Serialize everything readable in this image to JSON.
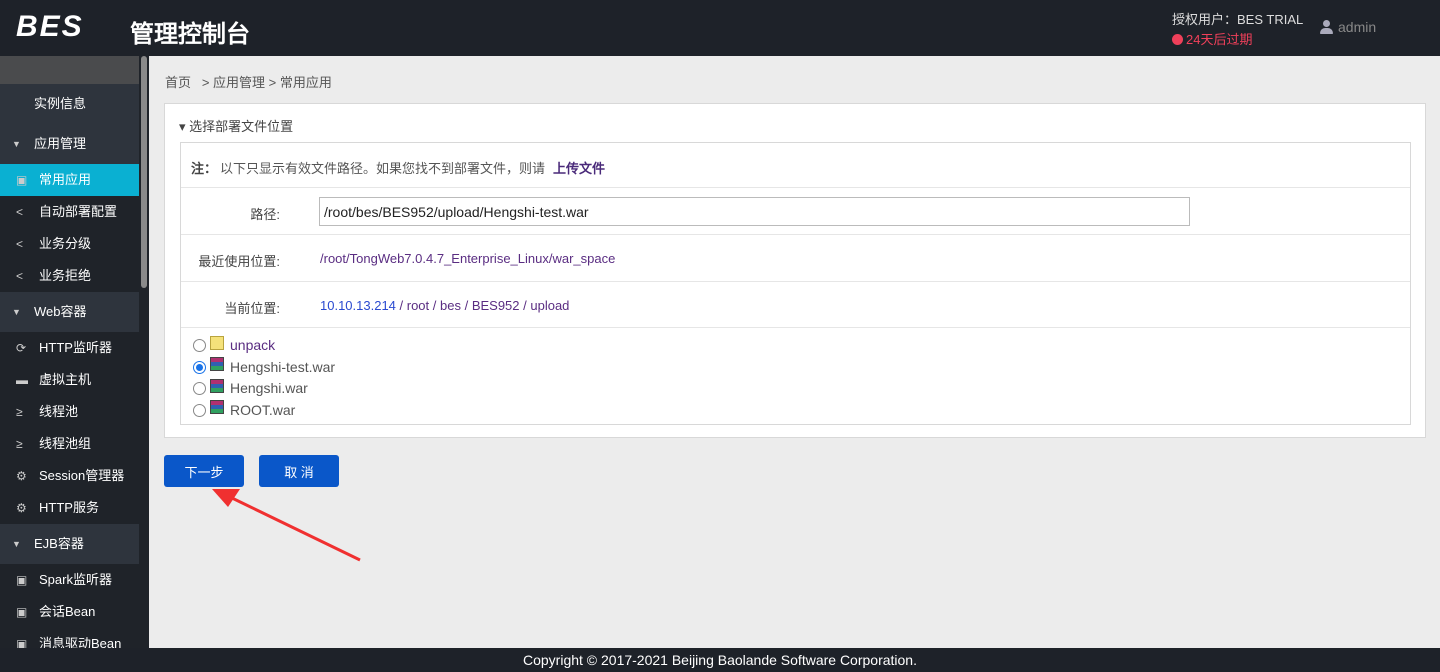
{
  "header": {
    "logo": "BES",
    "title": "管理控制台",
    "license": "授权用户：BES TRIAL",
    "expiry": "24天后过期",
    "user": "admin"
  },
  "sidebar": [
    {
      "type": "plain",
      "label": "实例信息"
    },
    {
      "type": "group",
      "label": "应用管理"
    },
    {
      "type": "item",
      "label": "常用应用",
      "icon": "app-icon",
      "active": true
    },
    {
      "type": "item",
      "label": "自动部署配置",
      "icon": "share-icon"
    },
    {
      "type": "item",
      "label": "业务分级",
      "icon": "share-icon"
    },
    {
      "type": "item",
      "label": "业务拒绝",
      "icon": "share-icon"
    },
    {
      "type": "group",
      "label": "Web容器"
    },
    {
      "type": "item",
      "label": "HTTP监听器",
      "icon": "sync-icon"
    },
    {
      "type": "item",
      "label": "虚拟主机",
      "icon": "monitor-icon"
    },
    {
      "type": "item",
      "label": "线程池",
      "icon": "thread-icon"
    },
    {
      "type": "item",
      "label": "线程池组",
      "icon": "thread-icon"
    },
    {
      "type": "item",
      "label": "Session管理器",
      "icon": "gear-icon"
    },
    {
      "type": "item",
      "label": "HTTP服务",
      "icon": "gear-icon"
    },
    {
      "type": "group",
      "label": "EJB容器"
    },
    {
      "type": "item",
      "label": "Spark监听器",
      "icon": "app-icon"
    },
    {
      "type": "item",
      "label": "会话Bean",
      "icon": "app-icon"
    },
    {
      "type": "item",
      "label": "消息驱动Bean",
      "icon": "app-icon"
    }
  ],
  "breadcrumb": "首页   > 应用管理 > 常用应用",
  "panel": {
    "title": "选择部署文件位置",
    "note_label": "注：",
    "note": "以下只显示有效文件路径。如果您找不到部署文件，则请",
    "upload_link": "上传文件",
    "path_label": "路径:",
    "path_value": "/root/bes/BES952/upload/Hengshi-test.war",
    "recent_label": "最近使用位置:",
    "recent_value": "/root/TongWeb7.0.4.7_Enterprise_Linux/war_space",
    "current_label": "当前位置:",
    "current_parts": [
      "10.10.13.214",
      "root",
      "bes",
      "BES952",
      "upload"
    ],
    "files": [
      {
        "name": "unpack",
        "type": "folder",
        "selected": false
      },
      {
        "name": "Hengshi-test.war",
        "type": "war",
        "selected": true
      },
      {
        "name": "Hengshi.war",
        "type": "war",
        "selected": false
      },
      {
        "name": "ROOT.war",
        "type": "war",
        "selected": false
      }
    ]
  },
  "buttons": {
    "next": "下一步",
    "cancel": "取 消"
  },
  "footer": "Copyright © 2017-2021 Beijing Baolande Software Corporation.",
  "colors": {
    "accent": "#0a57c9",
    "active": "#0ab0d2",
    "expiry": "#f0405a",
    "annotation_arrow": "#f03030"
  }
}
